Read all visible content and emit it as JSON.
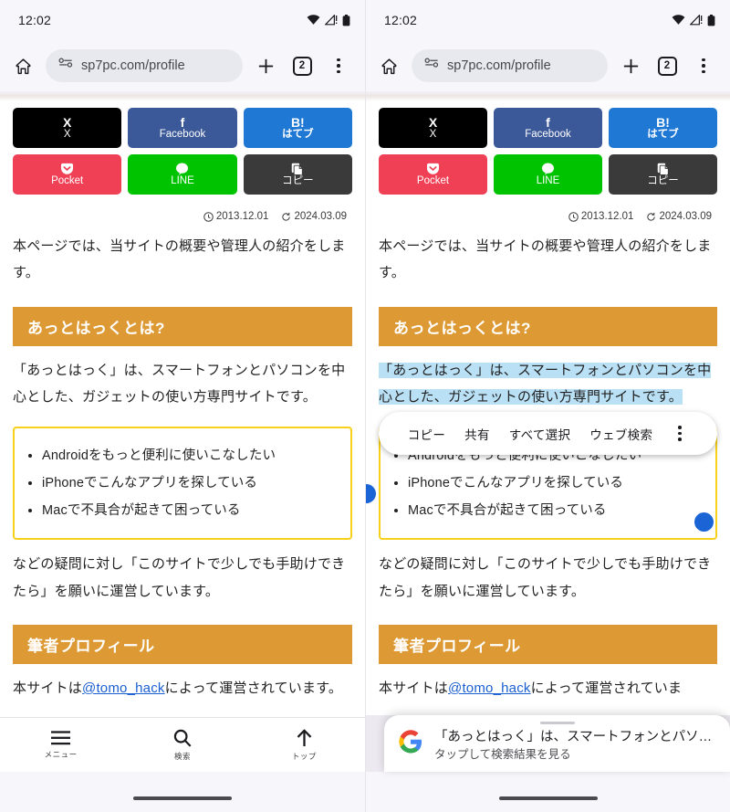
{
  "status": {
    "time": "12:02",
    "icons": [
      "wifi-icon",
      "signal-icon",
      "battery-icon"
    ]
  },
  "toolbar": {
    "home_icon": "home-icon",
    "site_info_icon": "site-info-icon",
    "url": "sp7pc.com/profile",
    "new_tab_label": "+",
    "tab_count": "2",
    "menu_icon": "overflow-menu-icon"
  },
  "share": {
    "buttons": [
      {
        "name": "x",
        "icon": "X",
        "label": "X",
        "bg": "#000000",
        "bold": false
      },
      {
        "name": "facebook",
        "icon": "f",
        "label": "Facebook",
        "bg": "#3b5998",
        "bold": false
      },
      {
        "name": "hatena",
        "icon": "B!",
        "label": "はてブ",
        "bg": "#1e78d4",
        "bold": true
      },
      {
        "name": "pocket",
        "icon": "▼",
        "label": "Pocket",
        "bg": "#ef4056",
        "bold": false
      },
      {
        "name": "line",
        "icon": "●",
        "label": "LINE",
        "bg": "#00c300",
        "bold": false
      },
      {
        "name": "copy",
        "icon": "❐",
        "label": "コピー",
        "bg": "#3a3a3a",
        "bold": false
      }
    ]
  },
  "article": {
    "published_icon": "clock-icon",
    "published": "2013.12.01",
    "updated_icon": "update-icon",
    "updated": "2024.03.09",
    "intro": "本ページでは、当サイトの概要や管理人の紹介をします。",
    "heading1": "あっとはっくとは?",
    "paragraph1": "「あっとはっく」は、スマートフォンとパソコンを中心とした、ガジェットの使い方専門サイトです。",
    "list": [
      "Androidをもっと便利に使いこなしたい",
      "iPhoneでこんなアプリを探している",
      "Macで不具合が起きて困っている"
    ],
    "paragraph2": "などの疑問に対し「このサイトで少しでも手助けできたら」を願いに運営しています。",
    "heading2": "筆者プロフィール",
    "paragraph3_before": "本サイトは",
    "profile_link": "@tomo_hack",
    "paragraph3_after": "によって運営されていま",
    "paragraph3_tail": "す。"
  },
  "bottomnav": {
    "items": [
      {
        "icon": "hamburger-icon",
        "label": "メニュー"
      },
      {
        "icon": "search-icon",
        "label": "検索"
      },
      {
        "icon": "arrow-up-icon",
        "label": "トップ"
      }
    ]
  },
  "selection_toolbar": {
    "items": [
      "コピー",
      "共有",
      "すべて選択",
      "ウェブ検索"
    ],
    "overflow_icon": "overflow-menu-icon"
  },
  "google_sheet": {
    "logo": "google-g-icon",
    "query": "「あっとはっく」は、スマートフォンとパソ…",
    "subtitle": "タップして検索結果を見る"
  },
  "colors": {
    "heading_orange": "#dd9933",
    "list_border_yellow": "#f7d119",
    "selection_highlight": "#b9e0f5",
    "handle_blue": "#1b64d6",
    "link_blue": "#1a5fd0"
  }
}
